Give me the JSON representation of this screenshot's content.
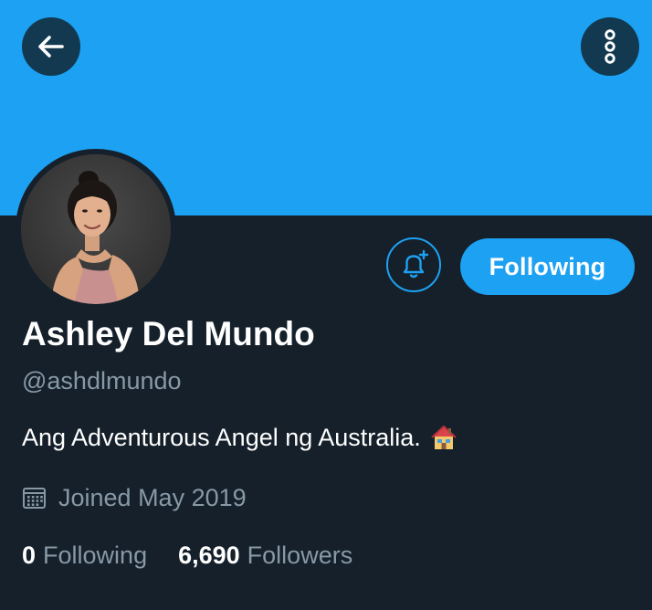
{
  "colors": {
    "banner": "#1da1f2",
    "background": "#15202b",
    "accent": "#1da1f2",
    "secondary_text": "#8899a6",
    "button_bg": "#12394f"
  },
  "header": {
    "back_icon": "arrow-left-icon",
    "more_icon": "more-vertical-icon"
  },
  "profile": {
    "display_name": "Ashley Del Mundo",
    "handle": "@ashdlmundo",
    "bio": "Ang Adventurous Angel ng Australia.",
    "bio_emoji": "house-emoji",
    "joined": "Joined May 2019",
    "joined_icon": "calendar-icon"
  },
  "actions": {
    "notify_icon": "bell-plus-icon",
    "follow_label": "Following"
  },
  "stats": {
    "following_count": "0",
    "following_label": "Following",
    "followers_count": "6,690",
    "followers_label": "Followers"
  }
}
